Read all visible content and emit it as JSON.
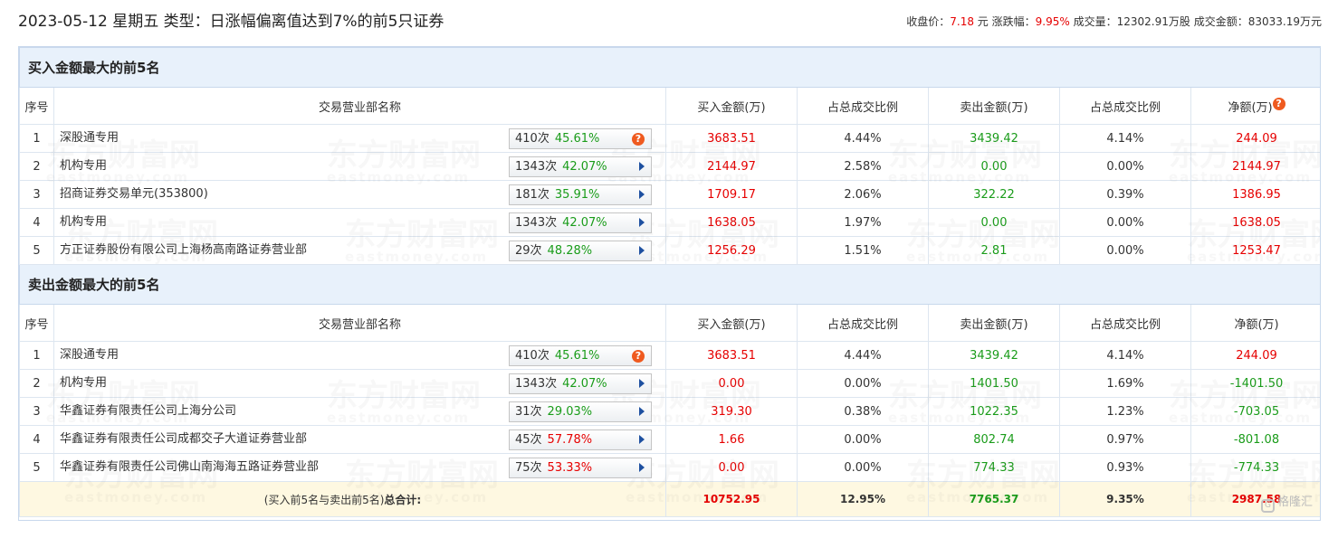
{
  "title": "2023-05-12 星期五 类型：日涨幅偏离值达到7%的前5只证券",
  "quote": {
    "close_label": "收盘价：",
    "close_value": "7.18",
    "close_unit": "元",
    "change_label": "涨跌幅：",
    "change_value": "9.95%",
    "volume_label": "成交量：",
    "volume_value": "12302.91万股",
    "amount_label": "成交金额：",
    "amount_value": "83033.19万元"
  },
  "columns": {
    "seq": "序号",
    "broker": "交易营业部名称",
    "buy": "买入金额(万)",
    "buy_ratio": "占总成交比例",
    "sell": "卖出金额(万)",
    "sell_ratio": "占总成交比例",
    "net": "净额(万)"
  },
  "buy_section": {
    "title": "买入金额最大的前5名",
    "rows": [
      {
        "seq": "1",
        "broker": "深股通专用",
        "times": "410次",
        "rate": "45.61%",
        "rate_color": "green",
        "icon": "question-icon",
        "buy": "3683.51",
        "buy_ratio": "4.44%",
        "sell": "3439.42",
        "sell_ratio": "4.14%",
        "net": "244.09",
        "net_color": "red"
      },
      {
        "seq": "2",
        "broker": "机构专用",
        "times": "1343次",
        "rate": "42.07%",
        "rate_color": "green",
        "icon": "arrow-right-icon",
        "buy": "2144.97",
        "buy_ratio": "2.58%",
        "sell": "0.00",
        "sell_ratio": "0.00%",
        "net": "2144.97",
        "net_color": "red"
      },
      {
        "seq": "3",
        "broker": "招商证券交易单元(353800)",
        "times": "181次",
        "rate": "35.91%",
        "rate_color": "green",
        "icon": "arrow-right-icon",
        "buy": "1709.17",
        "buy_ratio": "2.06%",
        "sell": "322.22",
        "sell_ratio": "0.39%",
        "net": "1386.95",
        "net_color": "red"
      },
      {
        "seq": "4",
        "broker": "机构专用",
        "times": "1343次",
        "rate": "42.07%",
        "rate_color": "green",
        "icon": "arrow-right-icon",
        "buy": "1638.05",
        "buy_ratio": "1.97%",
        "sell": "0.00",
        "sell_ratio": "0.00%",
        "net": "1638.05",
        "net_color": "red"
      },
      {
        "seq": "5",
        "broker": "方正证券股份有限公司上海杨高南路证券营业部",
        "times": "29次",
        "rate": "48.28%",
        "rate_color": "green",
        "icon": "arrow-right-icon",
        "buy": "1256.29",
        "buy_ratio": "1.51%",
        "sell": "2.81",
        "sell_ratio": "0.00%",
        "net": "1253.47",
        "net_color": "red"
      }
    ]
  },
  "sell_section": {
    "title": "卖出金额最大的前5名",
    "rows": [
      {
        "seq": "1",
        "broker": "深股通专用",
        "times": "410次",
        "rate": "45.61%",
        "rate_color": "green",
        "icon": "question-icon",
        "buy": "3683.51",
        "buy_ratio": "4.44%",
        "sell": "3439.42",
        "sell_ratio": "4.14%",
        "net": "244.09",
        "net_color": "red"
      },
      {
        "seq": "2",
        "broker": "机构专用",
        "times": "1343次",
        "rate": "42.07%",
        "rate_color": "green",
        "icon": "arrow-right-icon",
        "buy": "0.00",
        "buy_ratio": "0.00%",
        "sell": "1401.50",
        "sell_ratio": "1.69%",
        "net": "-1401.50",
        "net_color": "green"
      },
      {
        "seq": "3",
        "broker": "华鑫证券有限责任公司上海分公司",
        "times": "31次",
        "rate": "29.03%",
        "rate_color": "green",
        "icon": "arrow-right-icon",
        "buy": "319.30",
        "buy_ratio": "0.38%",
        "sell": "1022.35",
        "sell_ratio": "1.23%",
        "net": "-703.05",
        "net_color": "green"
      },
      {
        "seq": "4",
        "broker": "华鑫证券有限责任公司成都交子大道证券营业部",
        "times": "45次",
        "rate": "57.78%",
        "rate_color": "red",
        "icon": "arrow-right-icon",
        "buy": "1.66",
        "buy_ratio": "0.00%",
        "sell": "802.74",
        "sell_ratio": "0.97%",
        "net": "-801.08",
        "net_color": "green"
      },
      {
        "seq": "5",
        "broker": "华鑫证券有限责任公司佛山南海海五路证券营业部",
        "times": "75次",
        "rate": "53.33%",
        "rate_color": "red",
        "icon": "arrow-right-icon",
        "buy": "0.00",
        "buy_ratio": "0.00%",
        "sell": "774.33",
        "sell_ratio": "0.93%",
        "net": "-774.33",
        "net_color": "green"
      }
    ]
  },
  "total": {
    "label_prefix": "(买入前5名与卖出前5名)",
    "label_bold": "总合计:",
    "buy": "10752.95",
    "buy_ratio": "12.95%",
    "sell": "7765.37",
    "sell_ratio": "9.35%",
    "net": "2987.58"
  },
  "watermark": {
    "cn": "东方财富网",
    "en": "eastmoney.com"
  },
  "corner_logo": "格隆汇",
  "colors": {
    "red": "#e60000",
    "green": "#1a9c1a",
    "header_bg": "#e8f1fb",
    "total_bg": "#fef8e1",
    "icon_orange": "#ef5a1f",
    "arrow_blue": "#1e50a0"
  }
}
